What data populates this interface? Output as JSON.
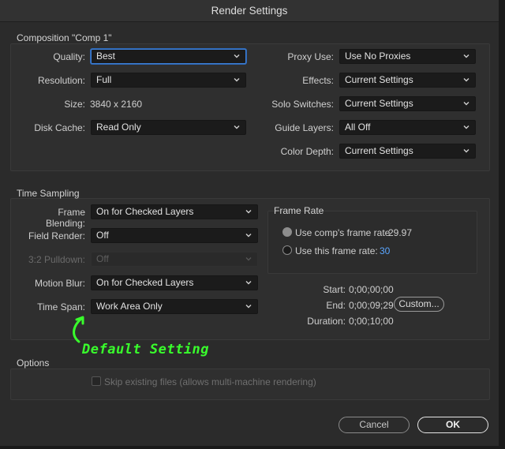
{
  "window": {
    "title": "Render Settings"
  },
  "composition": {
    "legend": "Composition \"Comp 1\"",
    "quality_label": "Quality:",
    "quality_value": "Best",
    "resolution_label": "Resolution:",
    "resolution_value": "Full",
    "size_label": "Size:",
    "size_value": "3840 x 2160",
    "disk_cache_label": "Disk Cache:",
    "disk_cache_value": "Read Only",
    "proxy_use_label": "Proxy Use:",
    "proxy_use_value": "Use No Proxies",
    "effects_label": "Effects:",
    "effects_value": "Current Settings",
    "solo_switches_label": "Solo Switches:",
    "solo_switches_value": "Current Settings",
    "guide_layers_label": "Guide Layers:",
    "guide_layers_value": "All Off",
    "color_depth_label": "Color Depth:",
    "color_depth_value": "Current Settings"
  },
  "time_sampling": {
    "legend": "Time Sampling",
    "frame_blending_label": "Frame Blending:",
    "frame_blending_value": "On for Checked Layers",
    "field_render_label": "Field Render:",
    "field_render_value": "Off",
    "pulldown_label": "3:2 Pulldown:",
    "pulldown_value": "Off",
    "motion_blur_label": "Motion Blur:",
    "motion_blur_value": "On for Checked Layers",
    "time_span_label": "Time Span:",
    "time_span_value": "Work Area Only",
    "frame_rate": {
      "legend": "Frame Rate",
      "use_comp_label": "Use comp's frame rate",
      "use_comp_value": "29.97",
      "use_this_label": "Use this frame rate:",
      "use_this_value": "30"
    },
    "start_label": "Start:",
    "start_value": "0;00;00;00",
    "end_label": "End:",
    "end_value": "0;00;09;29",
    "duration_label": "Duration:",
    "duration_value": "0;00;10;00",
    "custom_button": "Custom..."
  },
  "options": {
    "legend": "Options",
    "skip_existing_label": "Skip existing files (allows multi-machine rendering)"
  },
  "buttons": {
    "cancel": "Cancel",
    "ok": "OK"
  },
  "annotation": {
    "text": "Default Setting"
  },
  "colors": {
    "accent": "#3d7fd6",
    "annotation": "#39ff2c",
    "frame_rate_value": "#5aa6ff"
  },
  "icons": {
    "dropdown": "chevron-down-icon",
    "annotation_arrow": "curved-arrow-icon"
  }
}
